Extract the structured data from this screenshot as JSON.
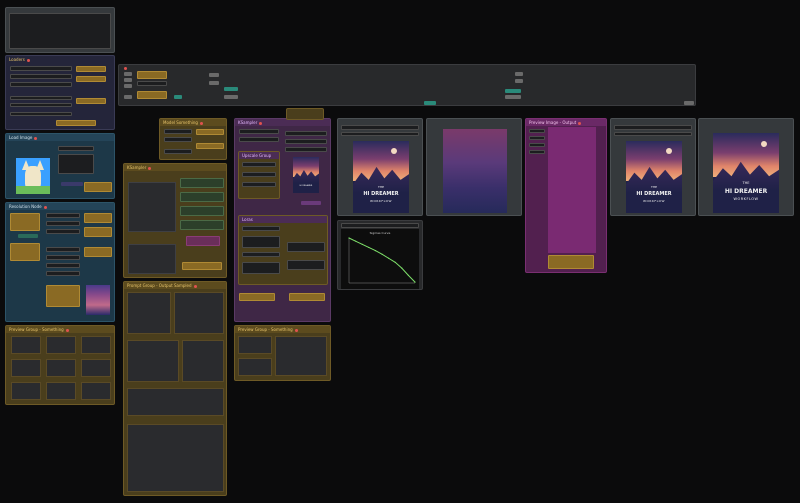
{
  "nodes": {
    "loaders": "Loaders",
    "load_image": "Load Image",
    "resolution_node": "Resolution Node",
    "preview_group_1": "Preview Group - Something",
    "model_group": "Model Something",
    "k_sampler_1": "KSampler",
    "prompt_group_1": "Prompt Group - Output Sampled",
    "prompt_group_2": "Preview Image - Output",
    "sampler_panel": "KSampler",
    "upscale_group": "Upscale Group",
    "loras": "Loras",
    "preview_group_2": "Preview Group - Something",
    "graph_title": "Sigmas Curve"
  },
  "poster": {
    "line1": "THE",
    "line2": "HI DREAMER",
    "line3": "WORKFLOW"
  },
  "chart_data": {
    "type": "line",
    "title": "Sigmas Curve",
    "xlabel": "",
    "ylabel": "",
    "x": [
      0,
      1,
      2,
      3,
      4,
      5,
      6,
      7,
      8,
      9,
      10
    ],
    "values": [
      1.0,
      0.93,
      0.86,
      0.79,
      0.72,
      0.64,
      0.55,
      0.46,
      0.33,
      0.17,
      0.02
    ],
    "ylim": [
      0,
      1
    ],
    "grid": false,
    "line_color": "#7ee06a"
  }
}
